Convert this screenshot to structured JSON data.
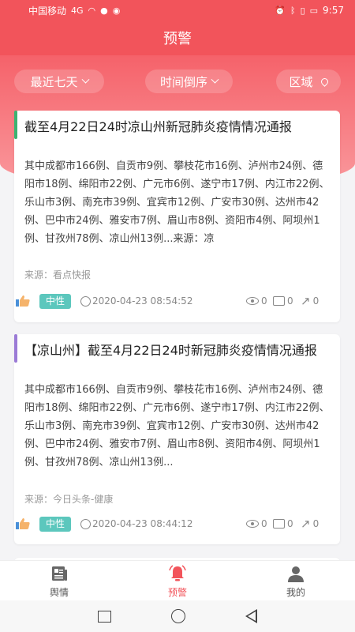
{
  "status_bar": {
    "carrier": "中国移动",
    "signal": "4G",
    "battery_icon": "battery-icon",
    "time": "9:57"
  },
  "header": {
    "title": "预警"
  },
  "filters": {
    "recent": "最近七天",
    "sort": "时间倒序",
    "region": "区域"
  },
  "cards": [
    {
      "title": "截至4月22日24时凉山州新冠肺炎疫情情况通报",
      "body": "其中成都市166例、自贡市9例、攀枝花市16例、泸州市24例、德阳市18例、绵阳市22例、广元市6例、遂宁市17例、内江市22例、乐山市3例、南充市39例、宜宾市12例、广安市30例、达州市42例、巴中市24例、雅安市7例、眉山市8例、资阳市4例、阿坝州1例、甘孜州78例、凉山州13例...来源：凉",
      "source": "来源：看点快报",
      "tag": "中性",
      "time": "2020-04-23 08:54:52",
      "views": "0",
      "comments": "0",
      "shares": "0",
      "accent": "#3cb371"
    },
    {
      "title": "【凉山州】截至4月22日24时新冠肺炎疫情情况通报",
      "body": "其中成都市166例、自贡市9例、攀枝花市16例、泸州市24例、德阳市18例、绵阳市22例、广元市6例、遂宁市17例、内江市22例、乐山市3例、南充市39例、宜宾市12例、广安市30例、达州市42例、巴中市24例、雅安市7例、眉山市8例、资阳市4例、阿坝州1例、甘孜州78例、凉山州13例...",
      "source": "来源：今日头条-健康",
      "tag": "中性",
      "time": "2020-04-23 08:44:12",
      "views": "0",
      "comments": "0",
      "shares": "0",
      "accent": "#9b7bd6"
    }
  ],
  "tabbar": {
    "items": [
      {
        "label": "舆情",
        "icon": "newspaper-icon"
      },
      {
        "label": "预警",
        "icon": "bell-icon"
      },
      {
        "label": "我的",
        "icon": "person-icon"
      }
    ]
  },
  "colors": {
    "primary": "#f2545b",
    "tag": "#5cc7bd"
  }
}
